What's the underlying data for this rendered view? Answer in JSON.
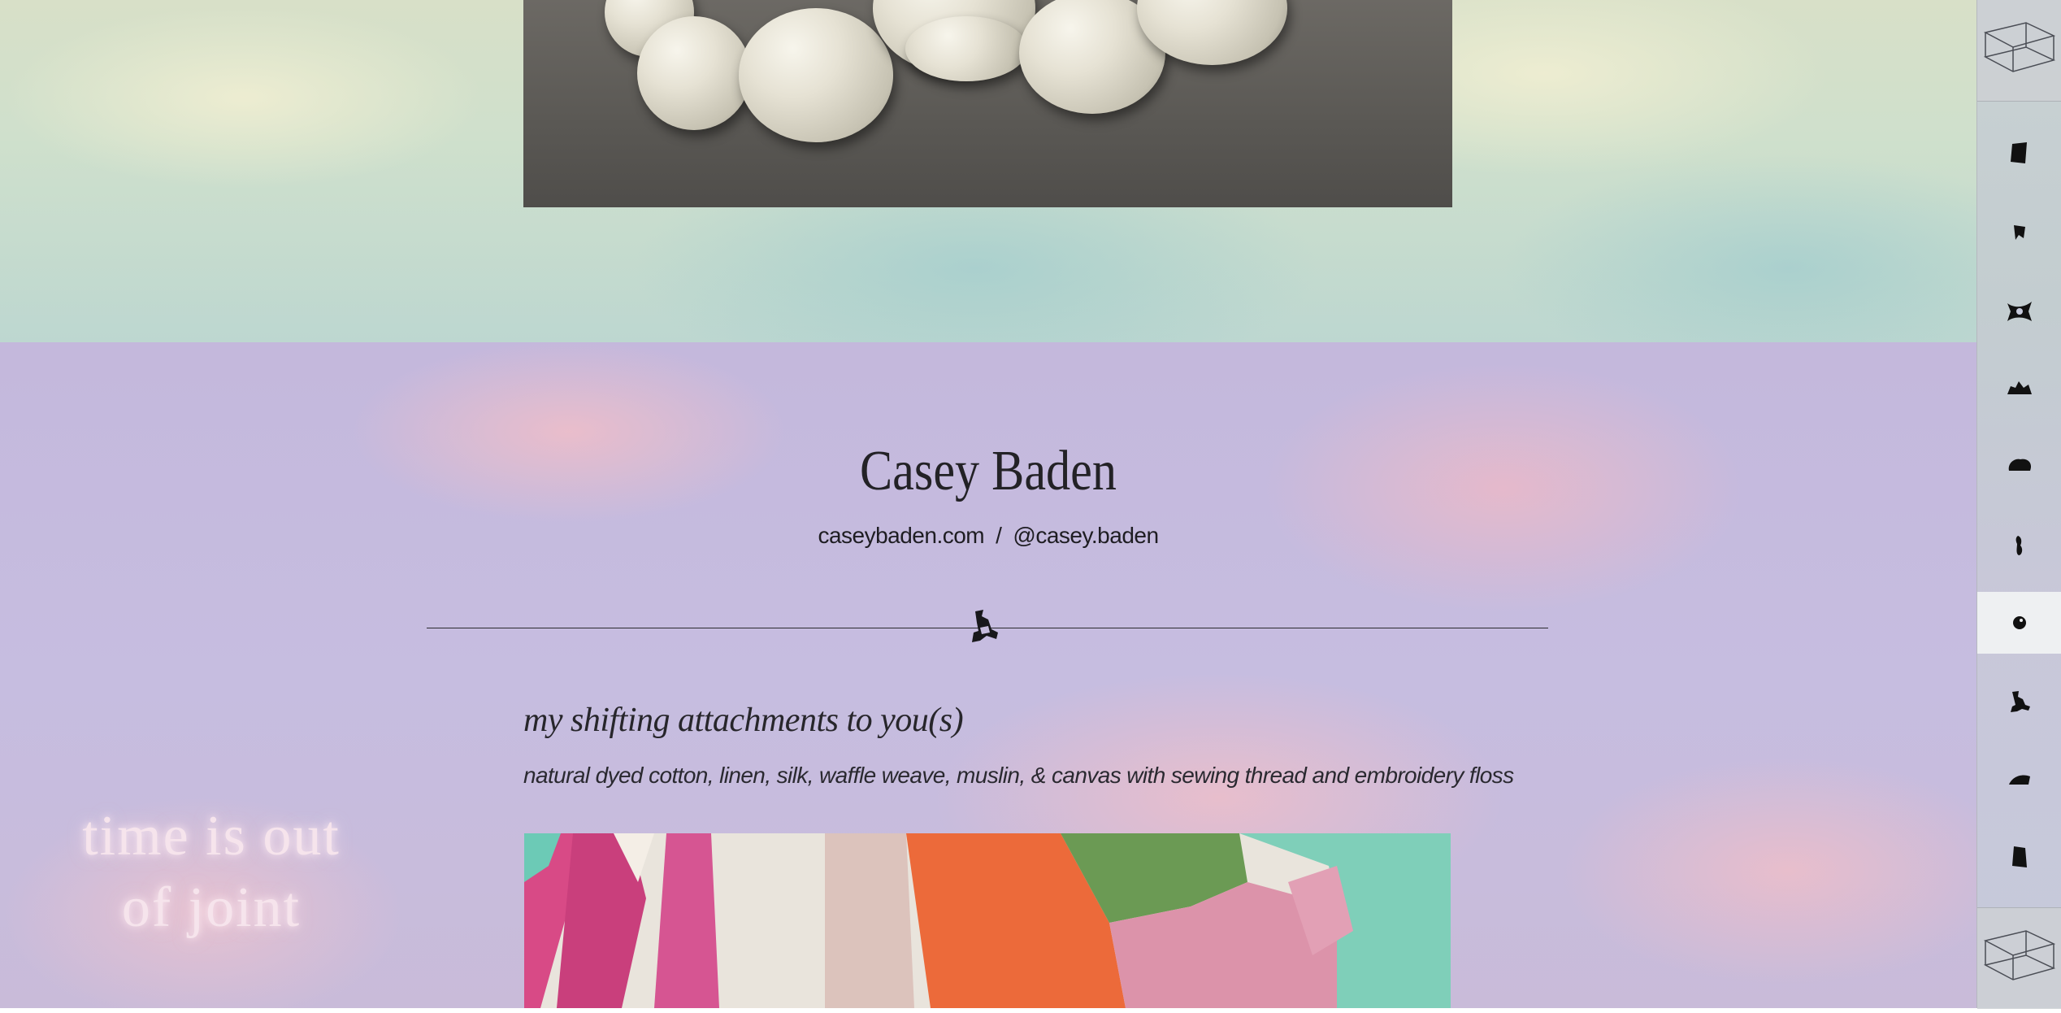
{
  "artist": {
    "name": "Casey Baden",
    "website": "caseybaden.com",
    "separator": "/",
    "instagram": "@casey.baden"
  },
  "work": {
    "title": "my shifting attachments to you(s)",
    "materials": "natural dyed cotton, linen, silk, waffle weave, muslin, & canvas with sewing thread and embroidery floss"
  },
  "floating_text": {
    "line1": "time is out",
    "line2": "of joint"
  },
  "sidebar": {
    "top_icon": "wireframe-box-icon",
    "bottom_icon": "wireframe-box-icon",
    "items": [
      {
        "icon": "blob-shape-1-icon"
      },
      {
        "icon": "blob-shape-2-icon"
      },
      {
        "icon": "blob-shape-3-icon"
      },
      {
        "icon": "blob-shape-4-icon"
      },
      {
        "icon": "blob-shape-5-icon"
      },
      {
        "icon": "blob-shape-6-icon"
      },
      {
        "icon": "blob-shape-7-icon",
        "active": true
      },
      {
        "icon": "blob-shape-8-icon"
      },
      {
        "icon": "blob-shape-9-icon"
      },
      {
        "icon": "blob-shape-10-icon"
      }
    ]
  },
  "colors": {
    "top_band": "#d3dfc8",
    "bottom_band": "#c6bcdc",
    "text": "#232226",
    "floating_text": "#f6e4ec"
  }
}
